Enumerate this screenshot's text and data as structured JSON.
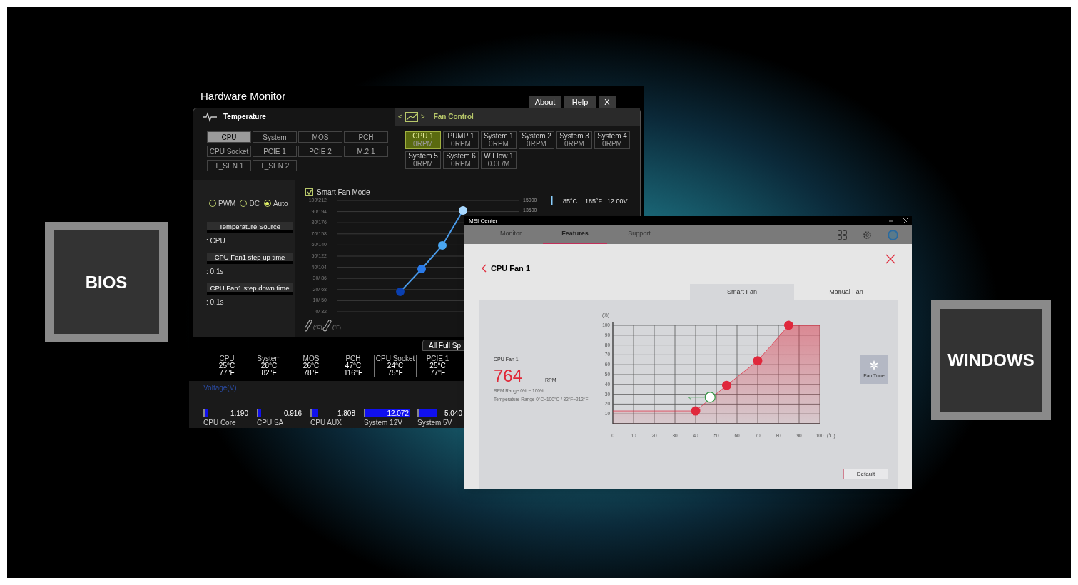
{
  "bios_label": "BIOS",
  "windows_label": "WINDOWS",
  "bios": {
    "title": "Hardware Monitor",
    "title_buttons": [
      "About",
      "Help",
      "X"
    ],
    "temperature_header": "Temperature",
    "fan_control_header": "Fan Control",
    "fan_nav": [
      "<",
      ">"
    ],
    "sensors": [
      {
        "label": "CPU",
        "selected": true
      },
      {
        "label": "System",
        "selected": false
      },
      {
        "label": "MOS",
        "selected": false
      },
      {
        "label": "PCH",
        "selected": false
      },
      {
        "label": "CPU Socket",
        "selected": false
      },
      {
        "label": "PCIE 1",
        "selected": false
      },
      {
        "label": "PCIE 2",
        "selected": false
      },
      {
        "label": "M.2 1",
        "selected": false
      },
      {
        "label": "T_SEN 1",
        "selected": false
      },
      {
        "label": "T_SEN 2",
        "selected": false
      }
    ],
    "fans": [
      {
        "name": "CPU 1",
        "reading": "0RPM",
        "selected": true
      },
      {
        "name": "PUMP 1",
        "reading": "0RPM",
        "selected": false
      },
      {
        "name": "System 1",
        "reading": "0RPM",
        "selected": false
      },
      {
        "name": "System 2",
        "reading": "0RPM",
        "selected": false
      },
      {
        "name": "System 3",
        "reading": "0RPM",
        "selected": false
      },
      {
        "name": "System 4",
        "reading": "0RPM",
        "selected": false
      },
      {
        "name": "System 5",
        "reading": "0RPM",
        "selected": false
      },
      {
        "name": "System 6",
        "reading": "0RPM",
        "selected": false
      },
      {
        "name": "W Flow 1",
        "reading": "0.0L/M",
        "selected": false
      }
    ],
    "modes": [
      {
        "label": "PWM",
        "selected": false
      },
      {
        "label": "DC",
        "selected": false
      },
      {
        "label": "Auto",
        "selected": true
      }
    ],
    "settings": [
      {
        "label": "Temperature Source",
        "value": ": CPU"
      },
      {
        "label": "CPU Fan1 step up time",
        "value": ": 0.1s"
      },
      {
        "label": "CPU Fan1 step down time",
        "value": ": 0.1s"
      }
    ],
    "smart_fan_mode": {
      "label": "Smart Fan Mode",
      "checked": true
    },
    "curve_y_labels": [
      "100/212",
      "90/194",
      "80/176",
      "70/158",
      "60/140",
      "50/122",
      "40/104",
      "30/ 86",
      "20/ 68",
      "10/ 50",
      "0/ 32"
    ],
    "curve_right_labels": [
      "15000",
      "13500"
    ],
    "reading": [
      "85°C",
      "185°F",
      "12.00V"
    ],
    "unit_labels": [
      "(°C)",
      "(°F)"
    ],
    "all_full_speed": "All Full Sp",
    "temps": [
      {
        "name": "CPU",
        "c": "25°C",
        "f": "77°F"
      },
      {
        "name": "System",
        "c": "28°C",
        "f": "82°F"
      },
      {
        "name": "MOS",
        "c": "26°C",
        "f": "78°F"
      },
      {
        "name": "PCH",
        "c": "47°C",
        "f": "116°F"
      },
      {
        "name": "CPU Socket",
        "c": "24°C",
        "f": "75°F"
      },
      {
        "name": "PCIE 1",
        "c": "25°C",
        "f": "77°F"
      }
    ],
    "voltage_title": "Voltage(V)",
    "voltages": [
      {
        "name": "CPU Core",
        "reading": "1.190",
        "level": 0.08
      },
      {
        "name": "CPU SA",
        "reading": "0.916",
        "level": 0.07
      },
      {
        "name": "CPU AUX",
        "reading": "1.808",
        "level": 0.15
      },
      {
        "name": "System 12V",
        "reading": "12.072",
        "level": 1.0
      },
      {
        "name": "System 5V",
        "reading": "5.040",
        "level": 0.42
      }
    ]
  },
  "msi": {
    "title": "MSI Center",
    "tabs": [
      {
        "label": "Monitor",
        "selected": false
      },
      {
        "label": "Features",
        "selected": true
      },
      {
        "label": "Support",
        "selected": false
      }
    ],
    "page_title": "CPU Fan 1",
    "mode_tabs": [
      {
        "label": "Smart Fan",
        "selected": true
      },
      {
        "label": "Manual Fan",
        "selected": false
      }
    ],
    "fan_name": "CPU Fan 1",
    "rpm": "764",
    "rpm_unit": "RPM",
    "ranges": [
      "RPM Range 0% ~ 100%",
      "Temperature Range 0°C~100°C / 32°F~212°F"
    ],
    "fan_tune": "Fan Tune",
    "default_button": "Default",
    "chart_data": {
      "type": "area",
      "xlabel": "(°C)",
      "ylabel": "(%)",
      "grid": true,
      "x": [
        0,
        40,
        55,
        70,
        85,
        100
      ],
      "values": [
        13,
        13,
        39,
        64,
        100,
        100
      ],
      "xlim": [
        0,
        100
      ],
      "ylim": [
        0,
        100
      ],
      "xticks": [
        0,
        10,
        20,
        30,
        40,
        50,
        60,
        70,
        80,
        90,
        100
      ],
      "yticks": [
        10,
        20,
        30,
        40,
        50,
        60,
        70,
        80,
        90,
        100
      ]
    },
    "current_temperature_marker": true
  }
}
